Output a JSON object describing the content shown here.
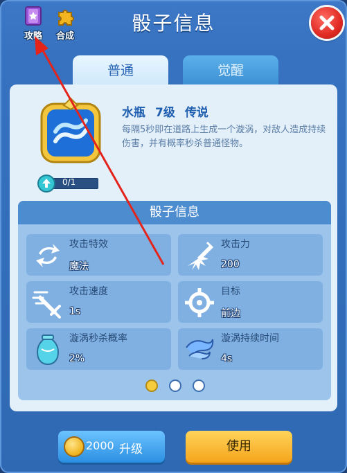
{
  "header": {
    "title": "骰子信息",
    "guide_label": "攻略",
    "compose_label": "合成"
  },
  "tabs": [
    {
      "label": "普通",
      "active": true
    },
    {
      "label": "觉醒",
      "active": false
    }
  ],
  "dice": {
    "name": "水瓶",
    "level": "7级",
    "rarity": "传说",
    "description": "每隔5秒即在道路上生成一个漩涡，对敌人造成持续伤害，并有概率秒杀普通怪物。",
    "progress_text": "0/1",
    "progress": 0
  },
  "stats": {
    "title": "骰子信息",
    "items": [
      {
        "label": "攻击特效",
        "value": "魔法",
        "icon": "arrows-cycle-icon"
      },
      {
        "label": "攻击力",
        "value": "200",
        "icon": "attack-burst-icon"
      },
      {
        "label": "攻击速度",
        "value": "1s",
        "icon": "sword-speed-icon"
      },
      {
        "label": "目标",
        "value": "前边",
        "icon": "crosshair-icon"
      },
      {
        "label": "漩涡秒杀概率",
        "value": "2%",
        "icon": "vase-icon"
      },
      {
        "label": "漩涡持续时间",
        "value": "4s",
        "icon": "whirl-icon"
      }
    ]
  },
  "pager": {
    "count": 3,
    "active": 0
  },
  "buttons": {
    "upgrade_cost": "2000",
    "upgrade_label": "升级",
    "use_label": "使用"
  },
  "colors": {
    "accent": "#2a66b5",
    "annotation_arrow": "#e4231b",
    "coin": "#f1b21b"
  }
}
